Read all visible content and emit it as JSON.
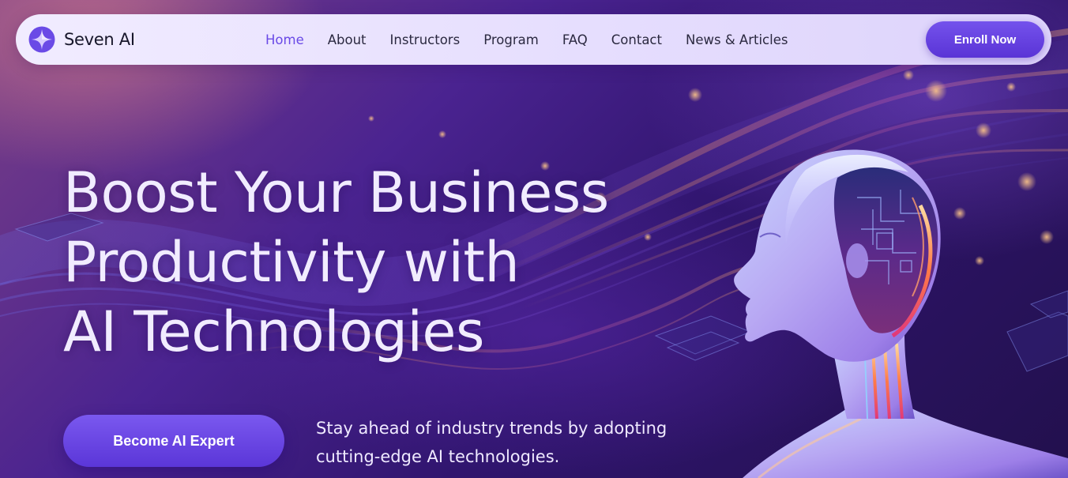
{
  "brand": {
    "name": "Seven AI",
    "icon": "sparkle-logo-icon"
  },
  "nav": {
    "items": [
      {
        "label": "Home",
        "active": true
      },
      {
        "label": "About",
        "active": false
      },
      {
        "label": "Instructors",
        "active": false
      },
      {
        "label": "Program",
        "active": false
      },
      {
        "label": "FAQ",
        "active": false
      },
      {
        "label": "Contact",
        "active": false
      },
      {
        "label": "News & Articles",
        "active": false
      }
    ],
    "enroll_label": "Enroll Now"
  },
  "hero": {
    "headline_lines": [
      "Boost Your Business",
      "Productivity with",
      "AI Technologies"
    ],
    "cta_label": "Become AI Expert",
    "tagline_lines": [
      "Stay ahead of industry trends by adopting",
      "cutting-edge AI technologies."
    ]
  },
  "colors": {
    "accent": "#6a4ae6",
    "button": "#5b36d8",
    "nav_bg": "#ebe4ff",
    "headline": "#f1ecff",
    "background": "#2a1352"
  }
}
